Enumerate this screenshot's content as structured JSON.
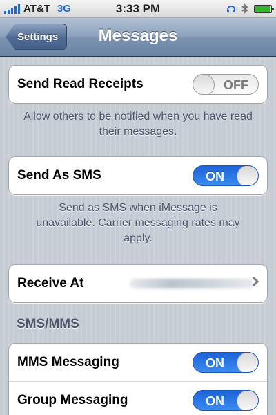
{
  "status_bar": {
    "carrier": "AT&T",
    "network": "3G",
    "time": "3:33 PM",
    "icons": [
      "signal-icon",
      "sync-icon",
      "bluetooth-icon",
      "battery-icon"
    ],
    "battery_level": 1.0
  },
  "nav": {
    "back_label": "Settings",
    "title": "Messages"
  },
  "settings": {
    "read_receipts": {
      "label": "Send Read Receipts",
      "state": "OFF"
    },
    "read_receipts_note": "Allow others to be notified when you have read their messages.",
    "send_as_sms": {
      "label": "Send As SMS",
      "state": "ON"
    },
    "send_as_sms_note": "Send as SMS when iMessage is unavailable. Carrier messaging rates may apply.",
    "receive_at": {
      "label": "Receive At"
    },
    "sms_mms_header": "SMS/MMS",
    "mms_messaging": {
      "label": "MMS Messaging",
      "state": "ON"
    },
    "group_messaging": {
      "label": "Group Messaging",
      "state": "ON"
    }
  },
  "colors": {
    "toggle_on": "#2f7ee8",
    "nav_bar": "#8a9fbb",
    "footnote_text": "#4c566c"
  }
}
